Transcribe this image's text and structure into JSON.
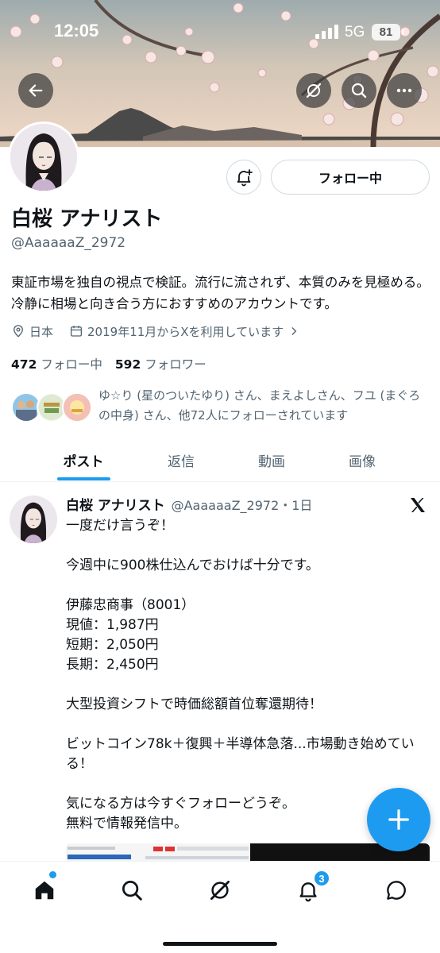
{
  "status_bar": {
    "time": "12:05",
    "network": "5G",
    "battery": "81"
  },
  "header": {
    "back_icon": "arrow-left-icon",
    "grok_icon": "grok-icon",
    "search_icon": "search-icon",
    "more_icon": "more-icon"
  },
  "profile": {
    "display_name": "白桜 アナリスト",
    "handle": "@AaaaaaZ_2972",
    "follow_button_label": "フォロー中",
    "bio": "東証市場を独自の視点で検証。流行に流されず、本質のみを見極める。冷静に相場と向き合う方におすすめのアカウントです。",
    "location": "日本",
    "joined": "2019年11月からXを利用しています",
    "following_count": "472",
    "following_label": "フォロー中",
    "followers_count": "592",
    "followers_label": "フォロワー",
    "followed_by_text": "ゆ☆り (星のついたゆり) さん、まえよしさん、フユ (まぐろの中身) さん、他72人にフォローされています"
  },
  "tabs": [
    {
      "label": "ポスト",
      "active": true
    },
    {
      "label": "返信",
      "active": false
    },
    {
      "label": "動画",
      "active": false
    },
    {
      "label": "画像",
      "active": false
    }
  ],
  "post": {
    "author_name": "白桜 アナリスト",
    "author_handle_time": "@AaaaaaZ_2972・1日",
    "body": "一度だけ言うぞ！\n\n今週中に900株仕込んでおけば十分です。\n\n伊藤忠商事（8001）\n現値：1,987円\n短期：2,050円\n長期：2,450円\n\n大型投資シフトで時価総額首位奪還期待！\n\nビットコイン78k＋復興＋半導体急落...市場動き始めている！\n\n気になる方は今すぐフォローどうぞ。\n無料で情報発信中。"
  },
  "bottom_nav": {
    "items": [
      "home-icon",
      "search-icon",
      "grok-icon",
      "notifications-icon",
      "messages-icon"
    ],
    "notification_badge": "3"
  },
  "colors": {
    "accent": "#1d9bf0",
    "text": "#0f1419",
    "secondary_text": "#536471",
    "border": "#cfd9de"
  }
}
